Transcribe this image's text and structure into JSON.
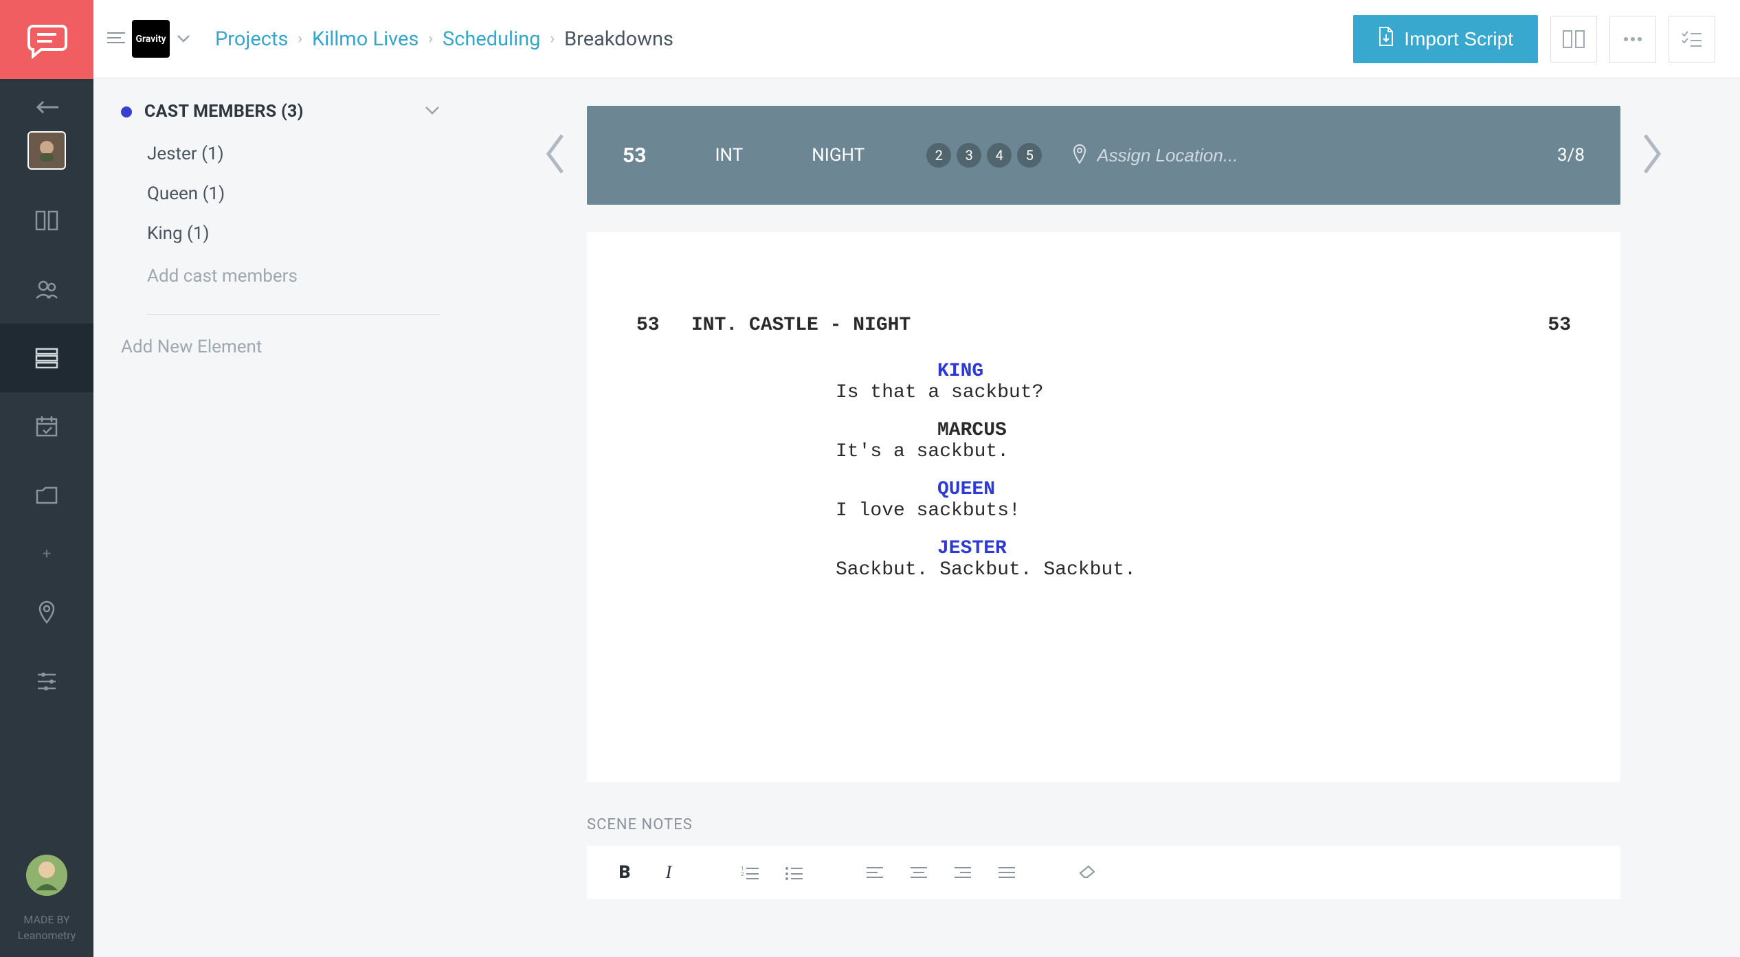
{
  "breadcrumb": {
    "projects": "Projects",
    "project_name": "Killmo Lives",
    "scheduling": "Scheduling",
    "current": "Breakdowns"
  },
  "project_box": "Gravity",
  "header": {
    "import": "Import Script"
  },
  "sidebar": {
    "category_title": "CAST MEMBERS (3)",
    "items": [
      "Jester (1)",
      "Queen (1)",
      "King (1)"
    ],
    "add_item": "Add cast members",
    "add_element": "Add New Element"
  },
  "scene": {
    "number": "53",
    "intext": "INT",
    "time": "NIGHT",
    "days": [
      "2",
      "3",
      "4",
      "5"
    ],
    "location_placeholder": "Assign Location...",
    "page_count": "3/8",
    "slugline": "INT. CASTLE - NIGHT",
    "slug_num_left": "53",
    "slug_num_right": "53",
    "dialogue": [
      {
        "char": "KING",
        "tagged": true,
        "line": "Is that a sackbut?"
      },
      {
        "char": "MARCUS",
        "tagged": false,
        "line": "It's a sackbut."
      },
      {
        "char": "QUEEN",
        "tagged": true,
        "line": "I love sackbuts!"
      },
      {
        "char": "JESTER",
        "tagged": true,
        "line": "Sackbut. Sackbut. Sackbut."
      }
    ]
  },
  "notes": {
    "label": "SCENE NOTES"
  },
  "footer": {
    "made_by": "MADE BY",
    "brand": "Leanometry"
  }
}
